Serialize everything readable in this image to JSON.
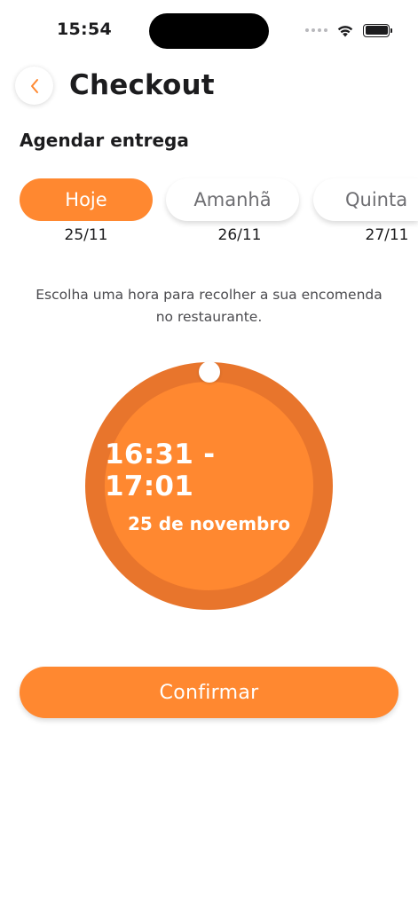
{
  "status_bar": {
    "time": "15:54"
  },
  "header": {
    "title": "Checkout",
    "back_icon": "chevron-left-icon"
  },
  "schedule": {
    "section_title": "Agendar entrega",
    "days": [
      {
        "label": "Hoje",
        "date": "25/11",
        "selected": true
      },
      {
        "label": "Amanhã",
        "date": "26/11",
        "selected": false
      },
      {
        "label": "Quinta",
        "date": "27/11",
        "selected": false
      }
    ],
    "instruction": "Escolha uma hora para recolher a sua encomenda no restaurante."
  },
  "time_picker": {
    "range": "16:31 - 17:01",
    "date": "25 de novembro"
  },
  "confirm": {
    "label": "Confirmar"
  },
  "colors": {
    "accent": "#ff8830",
    "accent_dark": "#e8752c",
    "back_icon": "#ff8830"
  }
}
